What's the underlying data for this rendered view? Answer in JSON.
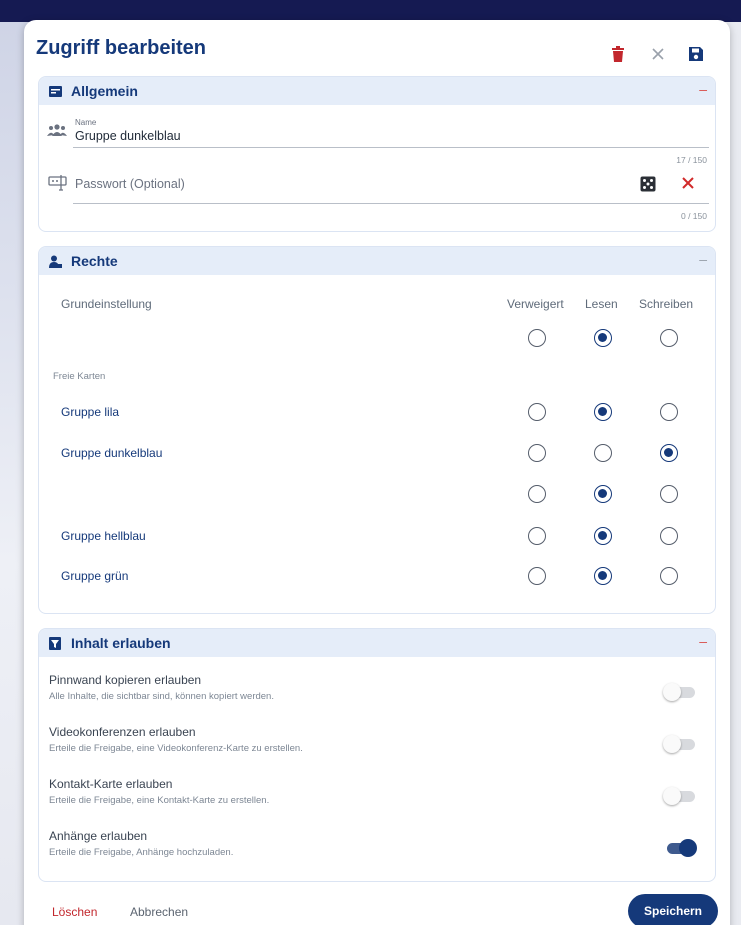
{
  "dialog": {
    "title": "Zugriff bearbeiten",
    "icons": [
      "trash-icon",
      "close-icon",
      "save-icon"
    ],
    "colors": {
      "primary": "#15397a",
      "danger": "#c2272d",
      "section_header_bg": "#e5edf9"
    }
  },
  "general": {
    "title": "Allgemein",
    "collapse": "–",
    "name_field": {
      "label": "Name",
      "value": "Gruppe dunkelblau",
      "counter": "17 / 150"
    },
    "password_field": {
      "placeholder": "Passwort (Optional)",
      "counter": "0 / 150"
    }
  },
  "rights": {
    "title": "Rechte",
    "collapse": "–",
    "default_label": "Grundeinstellung",
    "columns": [
      "Verweigert",
      "Lesen",
      "Schreiben"
    ],
    "default_selected": "Lesen",
    "cards_label": "Freie Karten",
    "rows": [
      {
        "label": "Gruppe lila",
        "selected": "Lesen"
      },
      {
        "label": "Gruppe dunkelblau",
        "selected": "Schreiben"
      },
      {
        "label": "",
        "selected": "Lesen"
      },
      {
        "label": "Gruppe hellblau",
        "selected": "Lesen"
      },
      {
        "label": "Gruppe grün",
        "selected": "Lesen"
      }
    ]
  },
  "content": {
    "title": "Inhalt erlauben",
    "collapse": "–",
    "options": [
      {
        "title": "Pinnwand kopieren erlauben",
        "desc": "Alle Inhalte, die sichtbar sind, können kopiert werden.",
        "enabled": false
      },
      {
        "title": "Videokonferenzen erlauben",
        "desc": "Erteile die Freigabe, eine Videokonferenz-Karte zu erstellen.",
        "enabled": false
      },
      {
        "title": "Kontakt-Karte erlauben",
        "desc": "Erteile die Freigabe, eine Kontakt-Karte zu erstellen.",
        "enabled": false
      },
      {
        "title": "Anhänge erlauben",
        "desc": "Erteile die Freigabe, Anhänge hochzuladen.",
        "enabled": true
      }
    ]
  },
  "footer": {
    "delete_label": "Löschen",
    "cancel_label": "Abbrechen",
    "save_label": "Speichern"
  }
}
